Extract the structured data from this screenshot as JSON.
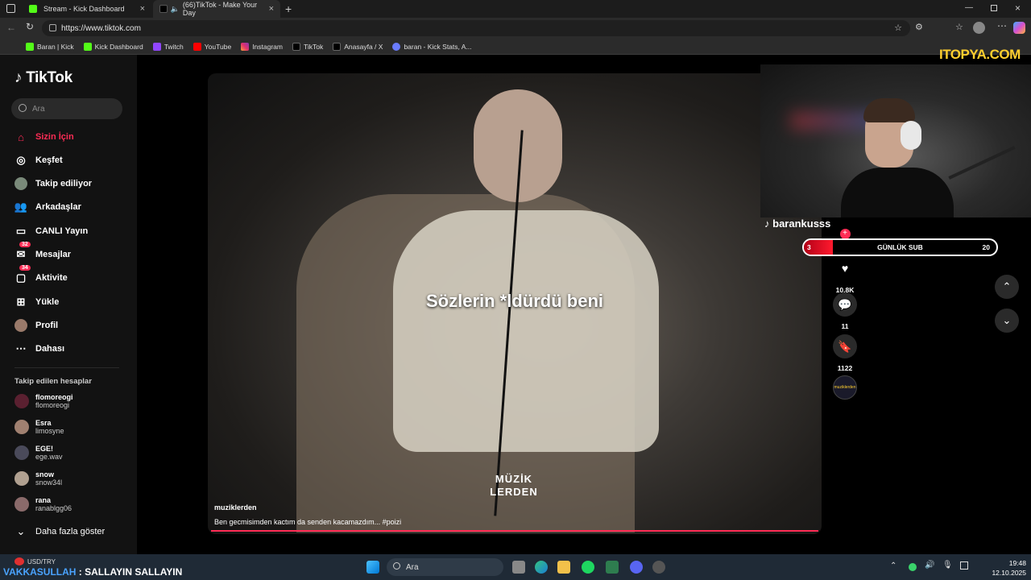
{
  "browser": {
    "tabs": [
      {
        "title": "Stream - Kick Dashboard",
        "active": false
      },
      {
        "title": "(66)TikTok - Make Your Day",
        "active": true
      }
    ],
    "url": "https://www.tiktok.com",
    "bookmarks": [
      "Baran | Kick",
      "Kick Dashboard",
      "Twitch",
      "YouTube",
      "Instagram",
      "TikTok",
      "Anasayfa / X",
      "baran - Kick Stats, A..."
    ]
  },
  "sidebar": {
    "logo": "TikTok",
    "search_placeholder": "Ara",
    "nav": [
      {
        "label": "Sizin İçin",
        "icon": "home-icon"
      },
      {
        "label": "Keşfet",
        "icon": "compass-icon"
      },
      {
        "label": "Takip ediliyor",
        "icon": "following-avatar-icon"
      },
      {
        "label": "Arkadaşlar",
        "icon": "friends-icon"
      },
      {
        "label": "CANLI Yayın",
        "icon": "live-icon"
      },
      {
        "label": "Mesajlar",
        "icon": "messages-icon",
        "badge": "32"
      },
      {
        "label": "Aktivite",
        "icon": "activity-icon",
        "badge": "34"
      },
      {
        "label": "Yükle",
        "icon": "upload-icon"
      },
      {
        "label": "Profil",
        "icon": "profile-avatar-icon"
      },
      {
        "label": "Dahası",
        "icon": "more-icon"
      }
    ],
    "following_title": "Takip edilen hesaplar",
    "accounts": [
      {
        "name": "flomoreogi",
        "handle": "flomoreogi"
      },
      {
        "name": "Esra",
        "handle": "limosyne"
      },
      {
        "name": "EGE!",
        "handle": "ege.wav"
      },
      {
        "name": "snow",
        "handle": "snow34l"
      },
      {
        "name": "rana",
        "handle": "ranablgg06"
      }
    ],
    "show_more": "Daha fazla göster"
  },
  "video": {
    "caption": "Sözlerin *ldürdü beni",
    "watermark_line1": "MÜZİK",
    "watermark_line2": "LERDEN",
    "author": "muziklerden",
    "description": "Ben gecmisimden kactım da senden kacamazdım... #poizi"
  },
  "actions": {
    "likes": "10.8K",
    "comments": "11",
    "saves": "1122",
    "sound_label": "muziklerden"
  },
  "stream_overlay": {
    "username": "barankusss",
    "brand": "ITOPYA.COM",
    "sub_label": "GÜNLÜK SUB",
    "sub_current": "3",
    "sub_goal": "20",
    "sub_fraction": 0.15
  },
  "taskbar": {
    "ticker_user": "VAKKASULLAH",
    "ticker_text": ": SALLAYIN SALLAYIN",
    "usd_label": "USD/TRY",
    "search_placeholder": "Ara",
    "time": "19:48",
    "date": "12.10.2025"
  }
}
